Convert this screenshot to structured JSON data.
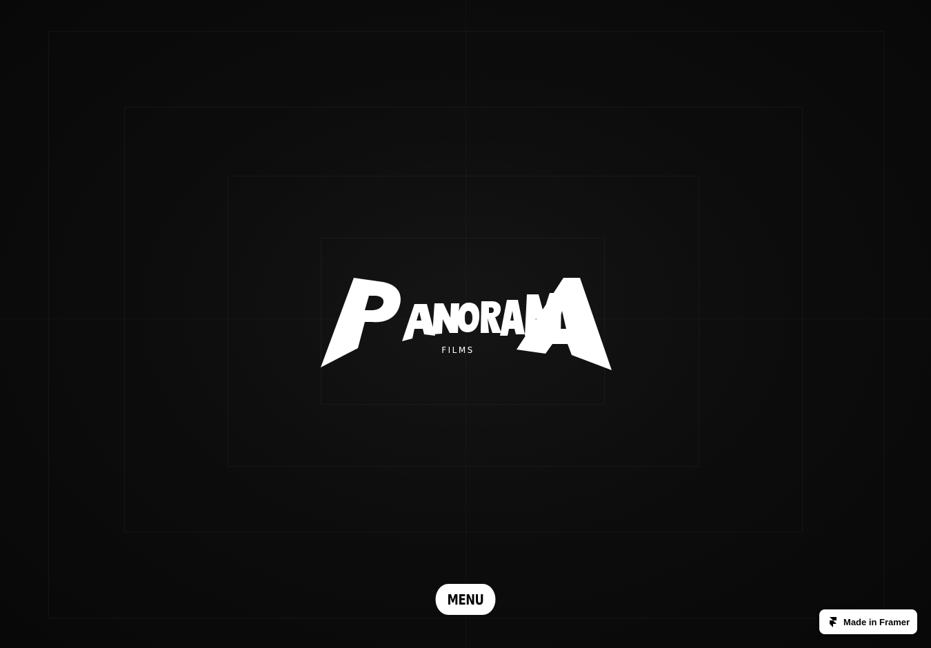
{
  "brand": {
    "name": "PANORAMA",
    "subtitle": "FILMS"
  },
  "nav": {
    "menu_label": "MENU"
  },
  "badge": {
    "label": "Made in Framer",
    "icon": "framer-icon"
  },
  "colors": {
    "background": "#0a0a0a",
    "logo": "#ffffff",
    "button_bg": "#ffffff",
    "button_text": "#000000"
  }
}
